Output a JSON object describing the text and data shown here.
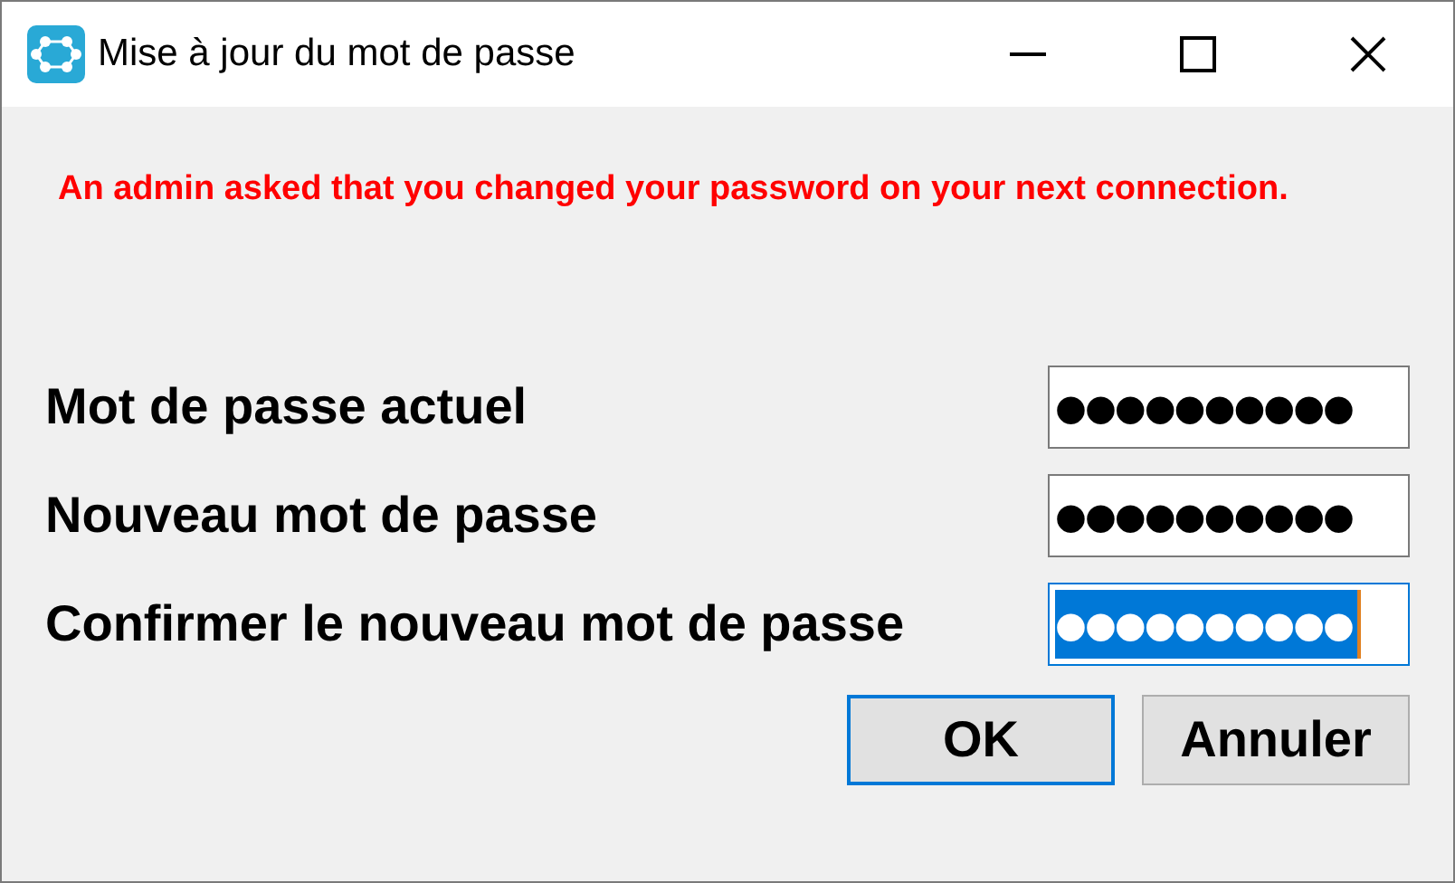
{
  "window": {
    "title": "Mise à jour du mot de passe"
  },
  "warning": "An admin asked that you changed your password on your next connection.",
  "fields": [
    {
      "label": "Mot de passe actuel",
      "value": "●●●●●●●●●●",
      "selected": false
    },
    {
      "label": "Nouveau mot de passe",
      "value": "●●●●●●●●●●",
      "selected": false
    },
    {
      "label": "Confirmer le nouveau mot de passe",
      "value": "●●●●●●●●●●",
      "selected": true
    }
  ],
  "buttons": [
    {
      "label": "OK",
      "default": true
    },
    {
      "label": "Annuler",
      "default": false
    }
  ]
}
